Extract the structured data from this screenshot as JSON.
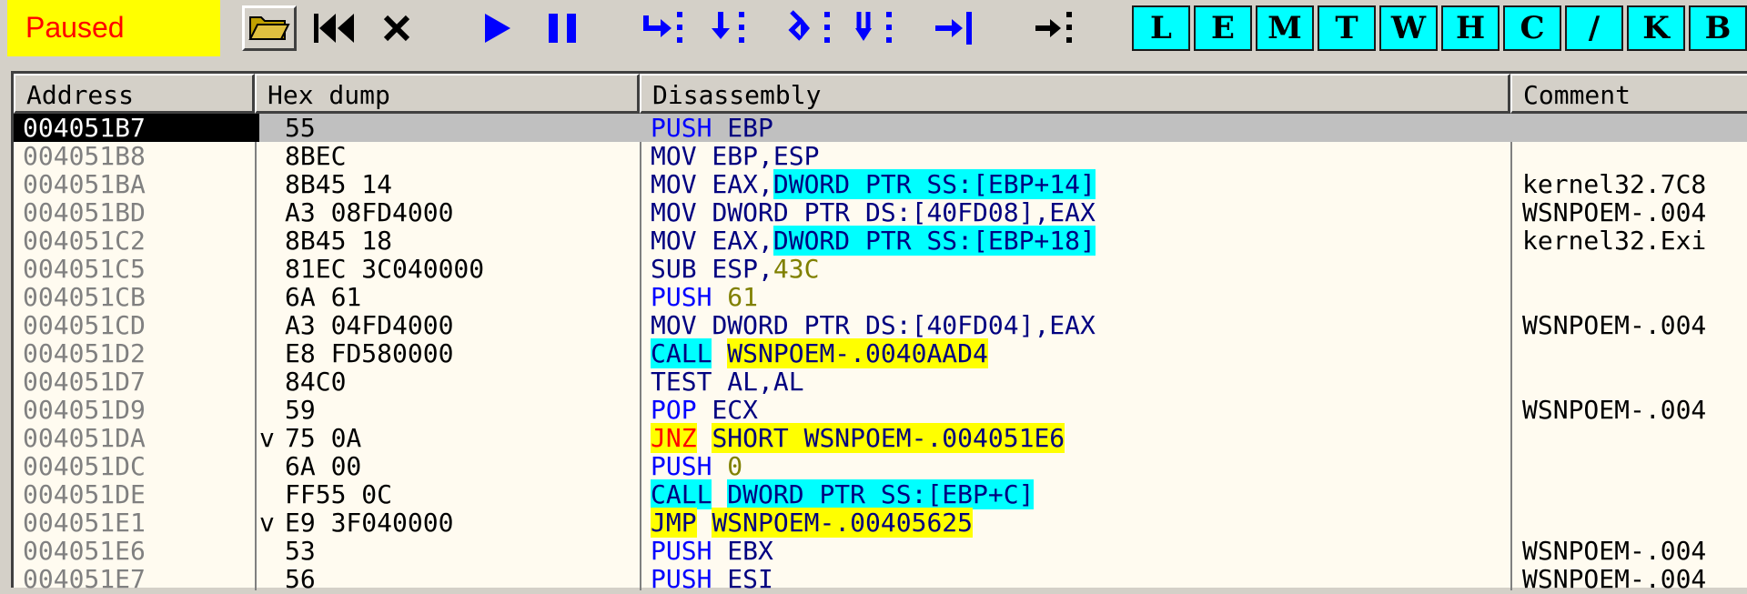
{
  "status": "Paused",
  "toolbar": {
    "icons": [
      "open-icon",
      "rewind-icon",
      "close-icon",
      "run-icon",
      "pause-icon",
      "step-into-icon",
      "step-over-icon",
      "trace-into-icon",
      "trace-over-icon",
      "execute-till-return-icon",
      "go-to-address-icon"
    ],
    "letter_buttons": [
      "L",
      "E",
      "M",
      "T",
      "W",
      "H",
      "C",
      "/",
      "K",
      "B"
    ]
  },
  "headers": {
    "address": "Address",
    "hex": "Hex dump",
    "disassembly": "Disassembly",
    "comment": "Comment"
  },
  "rows": [
    {
      "address": "004051B7",
      "arrow": "",
      "hex": "55",
      "dis": [
        {
          "t": "PUSH",
          "c": "blue"
        },
        {
          "t": " EBP",
          "c": "navy"
        }
      ],
      "comment": "",
      "selected": true
    },
    {
      "address": "004051B8",
      "arrow": "",
      "hex": "8BEC",
      "dis": [
        {
          "t": "MOV EBP,ESP",
          "c": "navy"
        }
      ],
      "comment": ""
    },
    {
      "address": "004051BA",
      "arrow": "",
      "hex": "8B45 14",
      "dis": [
        {
          "t": "MOV EAX,",
          "c": "navy"
        },
        {
          "t": "DWORD PTR SS:[EBP+14]",
          "c": "navy",
          "hl": "cyan"
        }
      ],
      "comment": "kernel32.7C8"
    },
    {
      "address": "004051BD",
      "arrow": "",
      "hex": "A3 08FD4000",
      "dis": [
        {
          "t": "MOV ",
          "c": "navy"
        },
        {
          "t": "DWORD PTR DS:[40FD08]",
          "c": "navy"
        },
        {
          "t": ",EAX",
          "c": "navy"
        }
      ],
      "comment": "WSNPOEM-.004"
    },
    {
      "address": "004051C2",
      "arrow": "",
      "hex": "8B45 18",
      "dis": [
        {
          "t": "MOV EAX,",
          "c": "navy"
        },
        {
          "t": "DWORD PTR SS:[EBP+18]",
          "c": "navy",
          "hl": "cyan"
        }
      ],
      "comment": "kernel32.Exi"
    },
    {
      "address": "004051C5",
      "arrow": "",
      "hex": "81EC 3C040000",
      "dis": [
        {
          "t": "SUB ESP,",
          "c": "navy"
        },
        {
          "t": "43C",
          "c": "olive"
        }
      ],
      "comment": ""
    },
    {
      "address": "004051CB",
      "arrow": "",
      "hex": "6A 61",
      "dis": [
        {
          "t": "PUSH",
          "c": "blue"
        },
        {
          "t": " ",
          "c": "navy"
        },
        {
          "t": "61",
          "c": "olive"
        }
      ],
      "comment": ""
    },
    {
      "address": "004051CD",
      "arrow": "",
      "hex": "A3 04FD4000",
      "dis": [
        {
          "t": "MOV ",
          "c": "navy"
        },
        {
          "t": "DWORD PTR DS:[40FD04]",
          "c": "navy"
        },
        {
          "t": ",EAX",
          "c": "navy"
        }
      ],
      "comment": "WSNPOEM-.004"
    },
    {
      "address": "004051D2",
      "arrow": "",
      "hex": "E8 FD580000",
      "dis": [
        {
          "t": "CALL",
          "c": "navy",
          "hl": "cyan"
        },
        {
          "t": " ",
          "c": "navy"
        },
        {
          "t": "WSNPOEM-.0040AAD4",
          "c": "navy",
          "hl": "yel"
        }
      ],
      "comment": ""
    },
    {
      "address": "004051D7",
      "arrow": "",
      "hex": "84C0",
      "dis": [
        {
          "t": "TEST AL,AL",
          "c": "navy"
        }
      ],
      "comment": ""
    },
    {
      "address": "004051D9",
      "arrow": "",
      "hex": "59",
      "dis": [
        {
          "t": "POP",
          "c": "blue"
        },
        {
          "t": " ECX",
          "c": "navy"
        }
      ],
      "comment": "WSNPOEM-.004"
    },
    {
      "address": "004051DA",
      "arrow": "v",
      "hex": "75 0A",
      "dis": [
        {
          "t": "JNZ",
          "c": "red",
          "hl": "yel"
        },
        {
          "t": " ",
          "c": "navy"
        },
        {
          "t": "SHORT WSNPOEM-.004051E6",
          "c": "navy",
          "hl": "yel"
        }
      ],
      "comment": ""
    },
    {
      "address": "004051DC",
      "arrow": "",
      "hex": "6A 00",
      "dis": [
        {
          "t": "PUSH",
          "c": "blue"
        },
        {
          "t": " ",
          "c": "navy"
        },
        {
          "t": "0",
          "c": "olive"
        }
      ],
      "comment": ""
    },
    {
      "address": "004051DE",
      "arrow": "",
      "hex": "FF55 0C",
      "dis": [
        {
          "t": "CALL",
          "c": "navy",
          "hl": "cyan"
        },
        {
          "t": " ",
          "c": "navy"
        },
        {
          "t": "DWORD PTR SS:[EBP+C]",
          "c": "navy",
          "hl": "cyan"
        }
      ],
      "comment": ""
    },
    {
      "address": "004051E1",
      "arrow": "v",
      "hex": "E9 3F040000",
      "dis": [
        {
          "t": "JMP",
          "c": "navy",
          "hl": "yel"
        },
        {
          "t": " ",
          "c": "navy"
        },
        {
          "t": "WSNPOEM-.00405625",
          "c": "navy",
          "hl": "yel"
        }
      ],
      "comment": ""
    },
    {
      "address": "004051E6",
      "arrow": "",
      "hex": "53",
      "dis": [
        {
          "t": "PUSH",
          "c": "blue"
        },
        {
          "t": " EBX",
          "c": "navy"
        }
      ],
      "comment": "WSNPOEM-.004"
    },
    {
      "address": "004051E7",
      "arrow": "",
      "hex": "56",
      "dis": [
        {
          "t": "PUSH",
          "c": "blue"
        },
        {
          "t": " ESI",
          "c": "navy"
        }
      ],
      "comment": "WSNPOEM-.004"
    }
  ]
}
